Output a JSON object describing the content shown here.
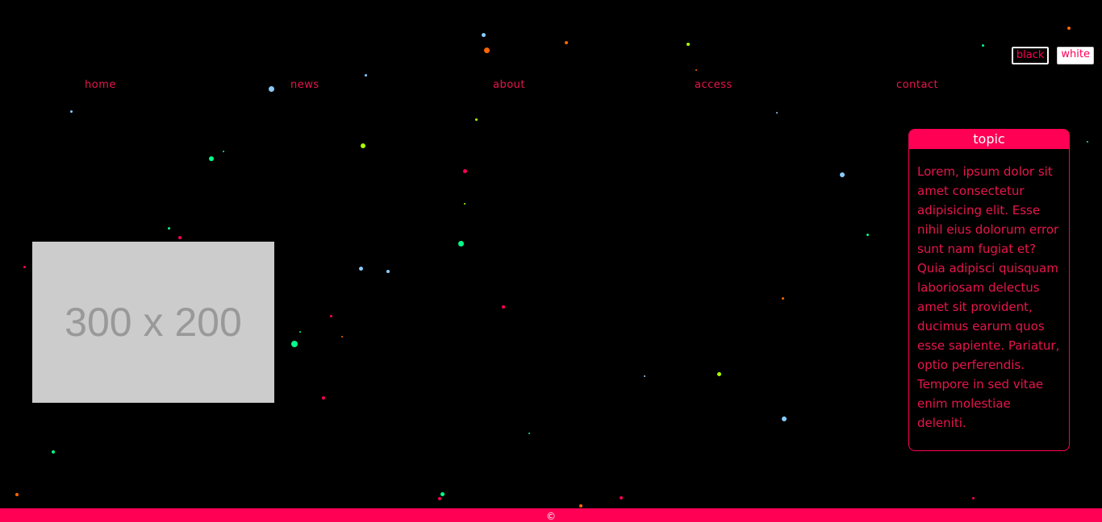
{
  "theme_switch": {
    "black_label": "black",
    "white_label": "white"
  },
  "nav": {
    "items": [
      {
        "label": "home"
      },
      {
        "label": "news"
      },
      {
        "label": "about"
      },
      {
        "label": "access"
      },
      {
        "label": "contact"
      }
    ]
  },
  "placeholder": {
    "label": "300 x 200"
  },
  "topic": {
    "title": "topic",
    "body": "Lorem, ipsum dolor sit amet consectetur adipisicing elit. Esse nihil eius dolorum error sunt nam fugiat et? Quia adipisci quisquam laboriosam delectus amet sit provident, ducimus earum quos esse sapiente. Pariatur, optio perferendis. Tempore in sed vitae enim molestiae deleniti."
  },
  "footer": {
    "text": "©"
  },
  "colors": {
    "accent": "#ff0055",
    "background": "#000000",
    "particles": [
      "#ff0055",
      "#00ff88",
      "#88ccff",
      "#ff6600",
      "#aaff00"
    ]
  }
}
